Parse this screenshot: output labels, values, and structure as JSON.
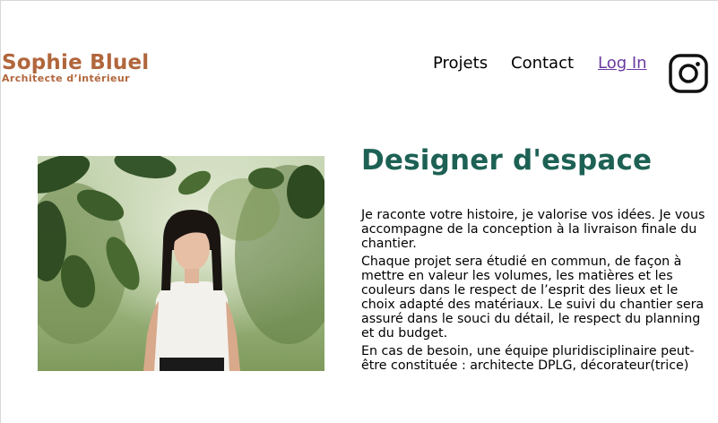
{
  "header": {
    "logo_title": "Sophie Bluel",
    "logo_subtitle": "Architecte d’intérieur",
    "nav": {
      "projets": "Projets",
      "contact": "Contact",
      "login": "Log In"
    },
    "instagram_icon": "instagram-icon"
  },
  "intro": {
    "title": "Designer d'espace",
    "paragraphs": [
      "Je raconte votre histoire, je valorise vos idées. Je vous accompagne de la conception à la livraison finale du chantier.",
      "Chaque projet sera étudié en commun, de façon à mettre en valeur les volumes, les matières et les couleurs dans le respect de l’esprit des lieux et le choix adapté des matériaux. Le suivi du chantier sera assuré dans le souci du détail, le respect du planning et du budget.",
      "En cas de besoin, une équipe pluridisciplinaire peut-être constituée : architecte DPLG, décorateur(trice)"
    ]
  },
  "colors": {
    "brand": "#B1663C",
    "title": "#1D6154",
    "link_visited": "#6a3aa0"
  }
}
